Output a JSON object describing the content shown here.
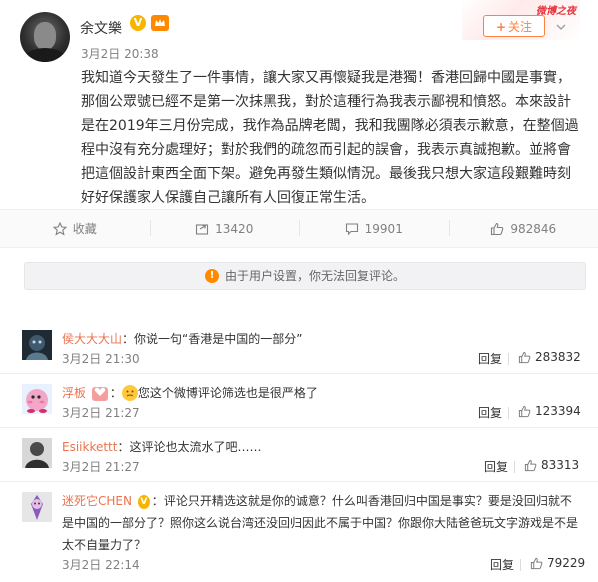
{
  "post": {
    "author": "余文樂",
    "vip_badge": "V",
    "time": "3月2日 20:38",
    "content": "我知道今天發生了一件事情，讓大家又再懷疑我是港獨！香港回歸中國是事實，那個公眾號已經不是第一次抹黑我，對於這種行為我表示鄙視和憤怒。本來設計是在2019年三月份完成，我作為品牌老闆，我和我團隊必須表示歉意，在整個過程中沒有充分處理好；對於我們的疏忽而引起的誤會，我表示真誠抱歉。並將會把這個設計東西全面下架。避免再發生類似情況。最後我只想大家這段艱難時刻好好保護家人保護自己讓所有人回復正常生活。",
    "follow_label": "关注",
    "follow_plus": "+",
    "promo_text": "微博之夜"
  },
  "actions": [
    {
      "icon": "star-icon",
      "label": "收藏"
    },
    {
      "icon": "share-icon",
      "label": "13420"
    },
    {
      "icon": "comment-icon",
      "label": "19901"
    },
    {
      "icon": "like-icon",
      "label": "982846"
    }
  ],
  "notice": {
    "text": "由于用户设置，你无法回复评论。",
    "icon_glyph": "!"
  },
  "comments": [
    {
      "name": "侯大大大山",
      "text": "你说一句“香港是中国的一部分”",
      "time": "3月2日 21:30",
      "reply": "回复",
      "likes": "283832"
    },
    {
      "name": "浮板",
      "text": "您这个微博评论筛选也是很严格了",
      "time": "3月2日 21:27",
      "reply": "回复",
      "likes": "123394"
    },
    {
      "name": "Esiikkettt",
      "text": "这评论也太流水了吧……",
      "time": "3月2日 21:27",
      "reply": "回复",
      "likes": "83313"
    },
    {
      "name": "迷死它CHEN",
      "text": "评论只开精选这就是你的诚意？什么叫香港回归中国是事实？要是没回归就不是中国的一部分了？照你这么说台湾还没回归因此不属于中国？你跟你大陆爸爸玩文字游戏是不是太不自量力了？",
      "time": "3月2日 22:14",
      "reply": "回复",
      "likes": "79229"
    }
  ],
  "colors": {
    "accent": "#ff8140",
    "name_link": "#eb7350",
    "vip": "#f7b500"
  }
}
